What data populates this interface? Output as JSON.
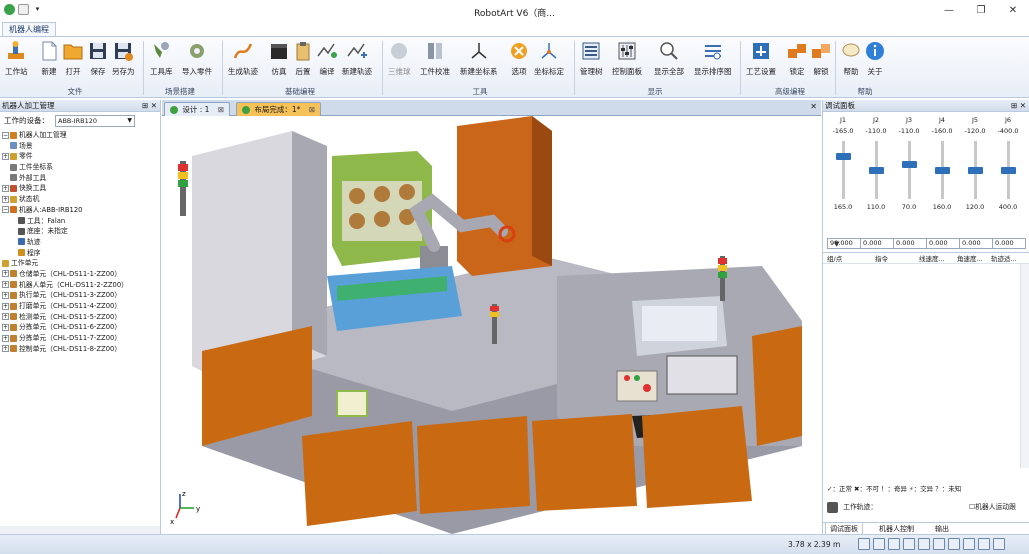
{
  "app": {
    "title": "RobotArt V6（商..."
  },
  "window_controls": {
    "minimize": "—",
    "maximize": "❐",
    "close": "✕"
  },
  "ribbon": {
    "tab": "机器人编程",
    "buttons": {
      "workstation": "工作站",
      "new": "新建",
      "open": "打开",
      "save": "保存",
      "save_as": "另存为",
      "toolbox": "工具库",
      "import_part": "导入零件",
      "gen_traj": "生成轨迹",
      "simulate": "仿真",
      "post": "后置",
      "compile": "编译",
      "new_traj": "新建轨迹",
      "three_point": "三维球",
      "calib": "工件校准",
      "new_coord": "新建坐标系",
      "options": "选项",
      "coord_calib": "坐标标定",
      "manager": "管理树",
      "control_panel": "控制面板",
      "show_all": "显示全部",
      "show_order": "显示排序图",
      "process_setup": "工艺设置",
      "lock": "锁定",
      "unlock": "解锁",
      "help": "帮助",
      "about": "关于"
    },
    "groups": {
      "file": "文件",
      "scene": "场景搭建",
      "basic_prog": "基础编程",
      "tools": "工具",
      "display": "显示",
      "advanced": "高级编程",
      "help": "帮助"
    }
  },
  "left_panel": {
    "title": "机器人加工管理",
    "pin": "⊞ ✕",
    "device_label": "工作的设备：",
    "device_value": "ABB-IRB120",
    "tree": [
      {
        "label": "机器人加工管理",
        "indent": 0,
        "exp": "−",
        "color": "#d08020"
      },
      {
        "label": "场景",
        "indent": 1,
        "exp": "",
        "color": "#6a8fc0"
      },
      {
        "label": "零件",
        "indent": 0,
        "exp": "+",
        "color": "#d0a030"
      },
      {
        "label": "工件坐标系",
        "indent": 1,
        "exp": "",
        "color": "#7a7a7a"
      },
      {
        "label": "外部工具",
        "indent": 1,
        "exp": "",
        "color": "#7a7a7a"
      },
      {
        "label": "快换工具",
        "indent": 0,
        "exp": "+",
        "color": "#c05030"
      },
      {
        "label": "状态机",
        "indent": 0,
        "exp": "+",
        "color": "#d0a030"
      },
      {
        "label": "机器人:ABB-IRB120",
        "indent": 0,
        "exp": "−",
        "color": "#d07020"
      },
      {
        "label": "工具：Falan",
        "indent": 2,
        "exp": "",
        "color": "#555"
      },
      {
        "label": "底座：未指定",
        "indent": 2,
        "exp": "",
        "color": "#555"
      },
      {
        "label": "轨迹",
        "indent": 2,
        "exp": "",
        "color": "#3a6ab0"
      },
      {
        "label": "程序",
        "indent": 2,
        "exp": "",
        "color": "#d09020"
      },
      {
        "label": "工作单元",
        "indent": 0,
        "exp": "",
        "color": "#d0a030"
      },
      {
        "label": "仓储单元（CHL-DS11-1-ZZ00）",
        "indent": 0,
        "exp": "+",
        "color": "#c08030"
      },
      {
        "label": "机器人单元（CHL-DS11-2-ZZ00）",
        "indent": 0,
        "exp": "+",
        "color": "#c08030"
      },
      {
        "label": "执行单元（CHL-DS11-3-ZZ00）",
        "indent": 0,
        "exp": "+",
        "color": "#c08030"
      },
      {
        "label": "打磨单元（CHL-DS11-4-ZZ00）",
        "indent": 0,
        "exp": "+",
        "color": "#c08030"
      },
      {
        "label": "检测单元（CHL-DS11-5-ZZ00）",
        "indent": 0,
        "exp": "+",
        "color": "#c08030"
      },
      {
        "label": "分拣单元（CHL-DS11-6-ZZ00）",
        "indent": 0,
        "exp": "+",
        "color": "#c08030"
      },
      {
        "label": "分拣单元（CHL-DS11-7-ZZ00）",
        "indent": 0,
        "exp": "+",
        "color": "#c08030"
      },
      {
        "label": "控制单元（CHL-DS11-8-ZZ00）",
        "indent": 0,
        "exp": "+",
        "color": "#c08030"
      }
    ]
  },
  "doc_tabs": [
    {
      "label": "设计 : 1",
      "close": "⊠",
      "active": false
    },
    {
      "label": "布局完成：1*",
      "close": "⊠",
      "active": true
    }
  ],
  "doc_tab_close": "✕",
  "right_panel": {
    "title": "调试面板",
    "pin": "⊞ ✕",
    "joints": [
      {
        "name": "J1",
        "min": "-165.0",
        "max": "165.0",
        "value": "90.000",
        "level": 0.77
      },
      {
        "name": "J2",
        "min": "-110.0",
        "max": "110.0",
        "value": "0.000",
        "level": 0.5
      },
      {
        "name": "J3",
        "min": "-110.0",
        "max": "70.0",
        "value": "0.000",
        "level": 0.61
      },
      {
        "name": "J4",
        "min": "-160.0",
        "max": "160.0",
        "value": "0.000",
        "level": 0.5
      },
      {
        "name": "J5",
        "min": "-120.0",
        "max": "120.0",
        "value": "0.000",
        "level": 0.5
      },
      {
        "name": "J6",
        "min": "-400.0",
        "max": "400.0",
        "value": "0.000",
        "level": 0.5
      }
    ],
    "table_headers": [
      "组/点",
      "指令",
      "线速度...",
      "角速度...",
      "轨迹适..."
    ],
    "legend": "✓：正常 ✖：不可 ！：奇异 ⚡：交异 ？：未知",
    "traj_label": "工作轨迹：",
    "robot_follow": "机器人运动跟",
    "bottom_tabs": [
      "调试面板",
      "机器人控制",
      "输出"
    ]
  },
  "status": {
    "dimensions": "3.78 x 2.39 m"
  },
  "viewport": {
    "axis_z": "z",
    "axis_y": "y",
    "axis_x": "x"
  }
}
